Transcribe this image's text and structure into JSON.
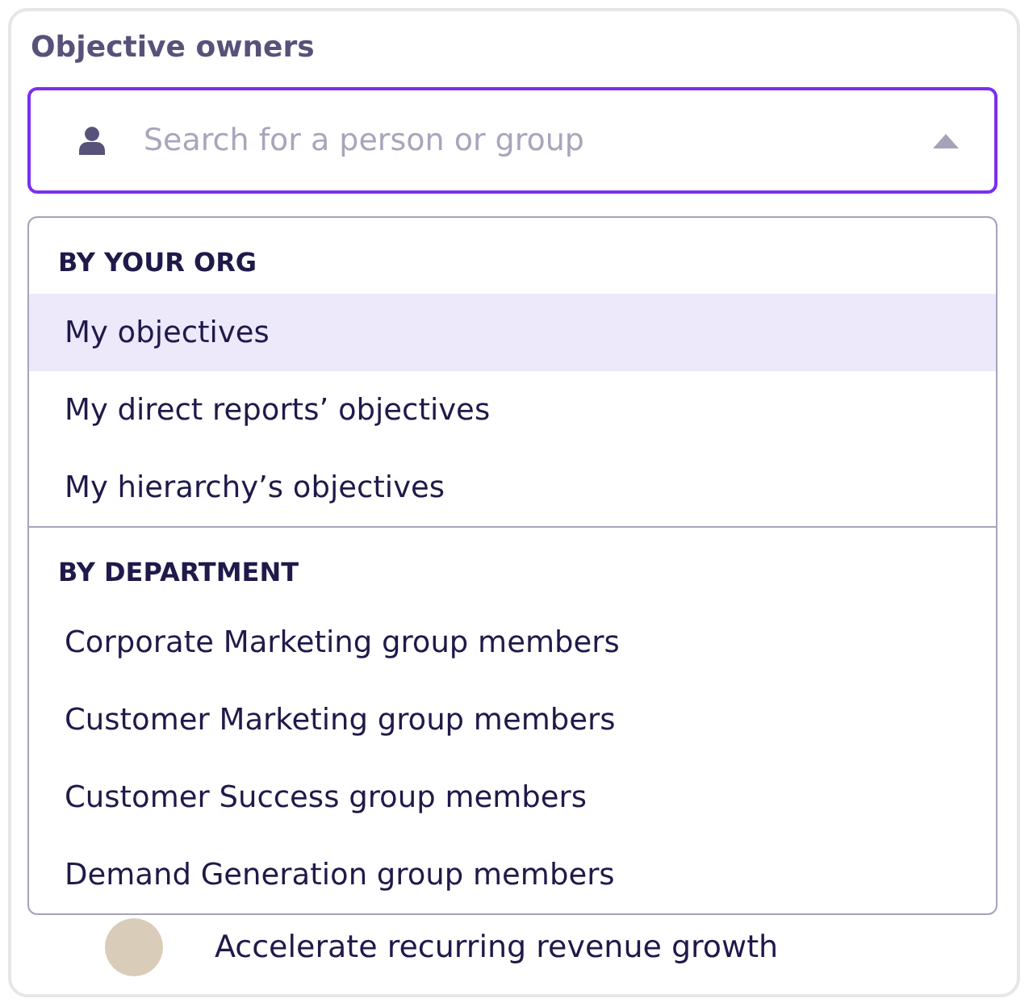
{
  "title": "Objective owners",
  "search": {
    "placeholder": "Search for a person or group",
    "expanded": true
  },
  "groups": [
    {
      "header": "BY YOUR ORG",
      "items": [
        {
          "label": "My objectives",
          "selected": true
        },
        {
          "label": "My direct reports’ objectives",
          "selected": false
        },
        {
          "label": "My hierarchy’s objectives",
          "selected": false
        }
      ]
    },
    {
      "header": "BY DEPARTMENT",
      "items": [
        {
          "label": "Corporate Marketing group members",
          "selected": false
        },
        {
          "label": "Customer Marketing group members",
          "selected": false
        },
        {
          "label": "Customer Success group members",
          "selected": false
        },
        {
          "label": "Demand Generation group members",
          "selected": false
        }
      ]
    }
  ],
  "objective_row": {
    "title": "Accelerate recurring revenue growth"
  }
}
